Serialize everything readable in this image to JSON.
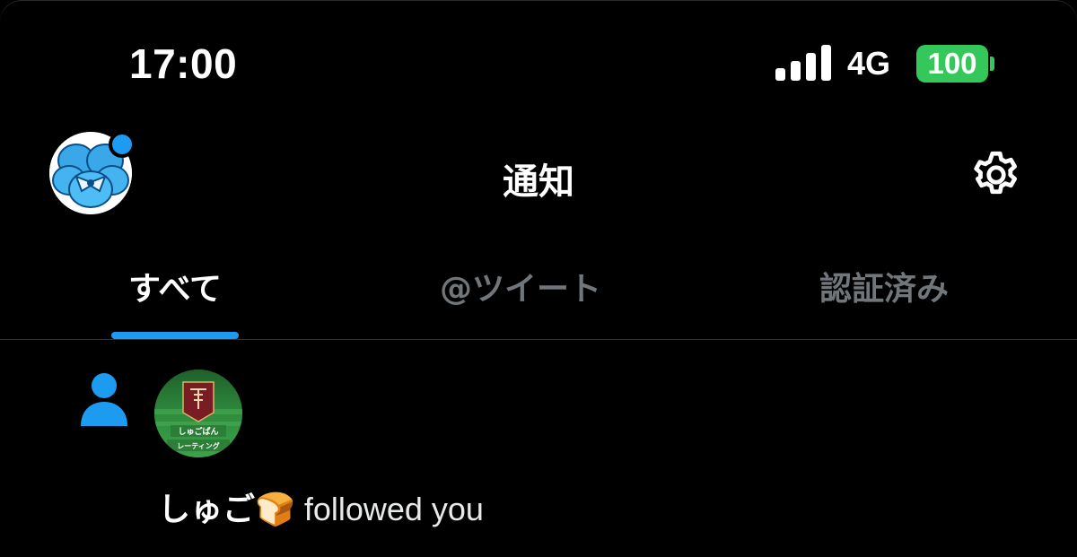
{
  "status_bar": {
    "time": "17:00",
    "network": "4G",
    "battery": "100",
    "signal_bars": 4
  },
  "header": {
    "title": "通知",
    "avatar_icon": "pansy-avatar-icon",
    "settings_icon": "gear-icon",
    "has_unread_dot": true
  },
  "tabs": [
    {
      "label": "すべて",
      "active": true
    },
    {
      "label": "@ツイート",
      "active": false
    },
    {
      "label": "認証済み",
      "active": false
    }
  ],
  "notification": {
    "type_icon": "person-icon",
    "follower_name": "しゅご🍞",
    "action_text": " followed you",
    "follower_avatar": {
      "line1": "しゅごぱん",
      "line2": "レーティング"
    }
  },
  "colors": {
    "accent": "#1d9bf0",
    "battery": "#34c759",
    "background": "#000000",
    "muted_text": "#71767b"
  }
}
